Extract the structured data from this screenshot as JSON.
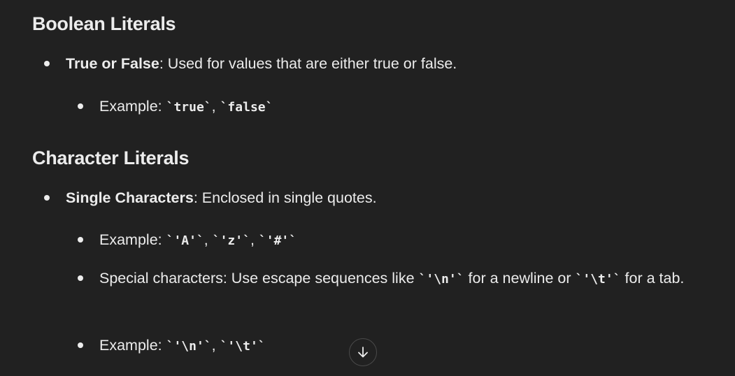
{
  "sections": [
    {
      "heading": "Boolean Literals",
      "items": [
        {
          "title": "True or False",
          "text": ": Used for values that are either true or false.",
          "subitems": [
            {
              "label": "Example: ",
              "codes": [
                "`true`",
                "`false`"
              ]
            }
          ]
        }
      ]
    },
    {
      "heading": "Character Literals",
      "items": [
        {
          "title": "Single Characters",
          "text": ": Enclosed in single quotes.",
          "subitems": [
            {
              "label": "Example: ",
              "codes": [
                "`'A'`",
                "`'z'`",
                "`'#'`"
              ]
            },
            {
              "label_before": "Special characters: Use escape sequences like ",
              "code1": "`'\\n'`",
              "middle": " for a newline or ",
              "code2": "`'\\t'`",
              "after": " for a tab."
            },
            {
              "label": "Example: ",
              "codes": [
                "`'\\n'`",
                "`'\\t'`"
              ]
            }
          ]
        }
      ]
    }
  ],
  "separator": ", ",
  "scroll_button": {
    "icon": "arrow-down-icon"
  }
}
